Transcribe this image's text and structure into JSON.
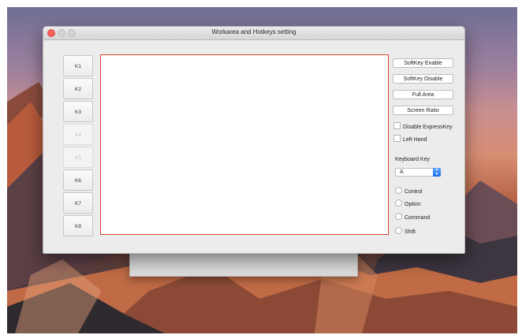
{
  "window": {
    "title": "Workarea and Hotkeys setting"
  },
  "keys": [
    {
      "label": "K1",
      "enabled": true
    },
    {
      "label": "K2",
      "enabled": true
    },
    {
      "label": "K3",
      "enabled": true
    },
    {
      "label": "K4",
      "enabled": false
    },
    {
      "label": "K5",
      "enabled": false
    },
    {
      "label": "K6",
      "enabled": true
    },
    {
      "label": "K7",
      "enabled": true
    },
    {
      "label": "K8",
      "enabled": true
    }
  ],
  "buttons": {
    "softkey_enable": "SoftKey Enable",
    "softkey_disable": "SoftKey Disable",
    "full_area": "Full Area",
    "screen_ratio": "Screen Ratio"
  },
  "checkboxes": {
    "disable_expresskey": "Disable ExpressKey",
    "left_hand": "Left Hand"
  },
  "keyboard": {
    "section_label": "Keyboard Key",
    "selected_key": "A"
  },
  "modifiers": {
    "control": "Control",
    "option": "Option",
    "command": "Command",
    "shift": "Shift"
  },
  "colors": {
    "canvas_border": "#d9432f",
    "close_button": "#fc605b",
    "select_accent": "#1f6fe8"
  }
}
